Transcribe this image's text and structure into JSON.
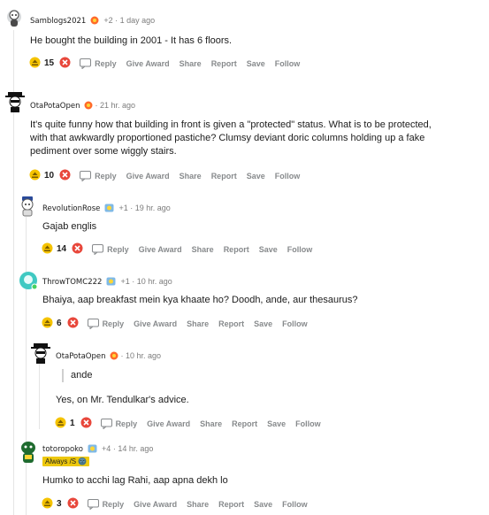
{
  "colors": {
    "upvote_bg": "#f5c300",
    "downvote_bg": "#e8473b",
    "flair_bg": "#edc80d",
    "meta_gray": "#7c7c7c",
    "action_gray": "#878a8c"
  },
  "actions": {
    "reply": "Reply",
    "give_award": "Give Award",
    "share": "Share",
    "report": "Report",
    "save": "Save",
    "follow": "Follow"
  },
  "comments": [
    {
      "user": "Samblogs2021",
      "karma": "+2",
      "time": "1 day ago",
      "body": "He bought the building in 2001 - It has 6 floors.",
      "votes": "15"
    },
    {
      "user": "OtaPotaOpen",
      "karma": "",
      "time": "21 hr. ago",
      "body_lines": [
        "It's quite funny how that building in front is given a \"protected\" status. What is to be protected,",
        "with that awkwardly proportioned pastiche? Clumsy deviant doric columns holding up a fake",
        "pediment over some wiggly stairs."
      ],
      "votes": "10"
    },
    {
      "user": "RevolutionRose",
      "karma": "+1",
      "time": "19 hr. ago",
      "body": "Gajab englis",
      "votes": "14"
    },
    {
      "user": "ThrowTOMC222",
      "karma": "+1",
      "time": "10 hr. ago",
      "body": "Bhaiya, aap breakfast mein kya khaate ho? Doodh, ande, aur thesaurus?",
      "votes": "6"
    },
    {
      "user": "OtaPotaOpen",
      "karma": "",
      "time": "10 hr. ago",
      "quote": "ande",
      "body": "Yes, on Mr. Tendulkar's advice.",
      "votes": "1"
    },
    {
      "user": "totoropoko",
      "karma": "+4",
      "time": "14 hr. ago",
      "flair": "Always /S 🌚",
      "body": "Humko to acchi lag Rahi, aap apna dekh lo",
      "votes": "3"
    }
  ]
}
